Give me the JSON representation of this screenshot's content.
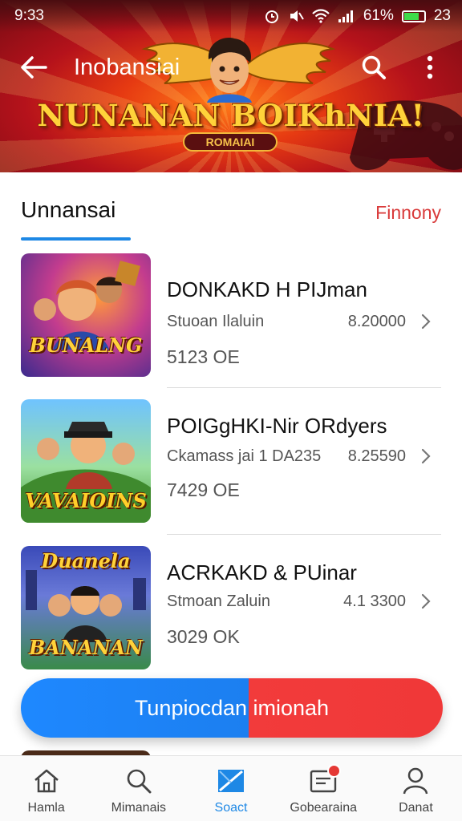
{
  "status_bar": {
    "time": "9:33",
    "battery_percent": "61%",
    "right_extra": "23"
  },
  "header": {
    "title": "Inobansiai",
    "banner_title": "NUNANAN BOIKhNIA!",
    "banner_subtitle": "ROMAIAI"
  },
  "section": {
    "title": "Unnansai",
    "link": "Finnony"
  },
  "items": [
    {
      "name": "DONKAKD H PIJman",
      "subtitle": "Stuoan Ilaluin",
      "price": "8.20000",
      "stat": "5123 OE",
      "thumb_text": "BUNALNG"
    },
    {
      "name": "POIGgHKI-Nir ORdyers",
      "subtitle": "Ckamass jai 1 DA235",
      "price": "8.25590",
      "stat": "7429 OE",
      "thumb_text": "VAVAIOINS"
    },
    {
      "name": "ACRKAKD & PUinar",
      "subtitle": "Stmoan Zaluin",
      "price": "4.1 3300",
      "stat": "3029 OK",
      "thumb_text_top": "Duanela",
      "thumb_text_bottom": "BANANAN"
    }
  ],
  "main_button": {
    "label": "Tunpiocdan imionah"
  },
  "bottom_nav": [
    {
      "label": "Hamla",
      "icon": "home-icon"
    },
    {
      "label": "Mimanais",
      "icon": "search-icon"
    },
    {
      "label": "Soact",
      "icon": "send-icon",
      "active": true
    },
    {
      "label": "Gobearaina",
      "icon": "inbox-icon",
      "badge": true
    },
    {
      "label": "Danat",
      "icon": "profile-icon"
    }
  ],
  "colors": {
    "accent_blue": "#1e88e5",
    "accent_red": "#f03838",
    "link_red": "#d93a3a",
    "banner_gold": "#ffd23a"
  }
}
